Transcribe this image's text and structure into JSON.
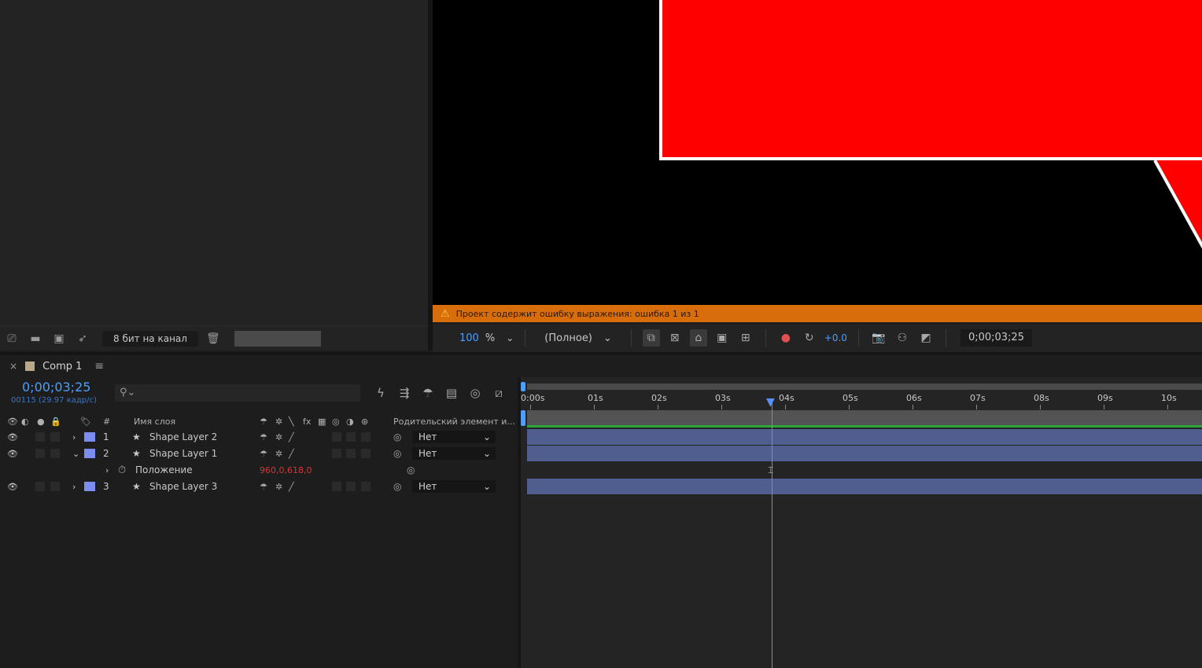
{
  "project": {
    "bit_depth": "8 бит на канал"
  },
  "viewer": {
    "warning": "Проект содержит ошибку выражения: ошибка 1 из 1",
    "zoom_value": "100",
    "zoom_unit": "%",
    "resolution": "(Полное)",
    "exposure": "+0.0",
    "timecode": "0;00;03;25"
  },
  "composition": {
    "tab_close": "×",
    "tab_title": "Comp 1",
    "current_time": "0;00;03;25",
    "frame_info": "00115 (29.97 кадр/с)",
    "search_placeholder": "⚲⌄"
  },
  "columns": {
    "num": "#",
    "layer_name": "Имя слоя",
    "parent": "Родительский элемент и..."
  },
  "layers": [
    {
      "num": "1",
      "name": "Shape Layer 2",
      "parent": "Нет"
    },
    {
      "num": "2",
      "name": "Shape Layer 1",
      "parent": "Нет"
    },
    {
      "num": "3",
      "name": "Shape Layer 3",
      "parent": "Нет"
    }
  ],
  "property": {
    "name": "Положение",
    "value": "960,0,618,0"
  },
  "ruler": [
    "0:00s",
    "01s",
    "02s",
    "03s",
    "04s",
    "05s",
    "06s",
    "07s",
    "08s",
    "09s",
    "10s"
  ],
  "colors": {
    "accent": "#4a9fff",
    "warning_bg": "#d86d0b",
    "shape_red": "#ff0000",
    "layer_bar": "#4f5d8f",
    "label_purple": "#7d8cf0"
  }
}
